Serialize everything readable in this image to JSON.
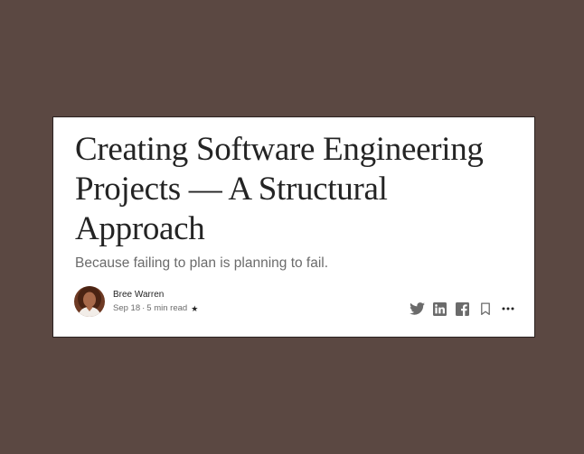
{
  "article": {
    "title": "Creating Software Engineering Projects — A Structural Approach",
    "subtitle": "Because failing to plan is planning to fail.",
    "author": "Bree Warren",
    "date": "Sep 18",
    "separator": "·",
    "read_time": "5 min read",
    "member_star": "★"
  },
  "actions": [
    {
      "icon": "twitter-icon"
    },
    {
      "icon": "linkedin-icon"
    },
    {
      "icon": "facebook-icon"
    },
    {
      "icon": "bookmark-icon"
    },
    {
      "icon": "more-icon"
    }
  ],
  "colors": {
    "background": "#5b4842",
    "card": "#ffffff",
    "title": "#242424",
    "subtitle": "#6b6b6b",
    "icon": "#6b6b6b"
  }
}
